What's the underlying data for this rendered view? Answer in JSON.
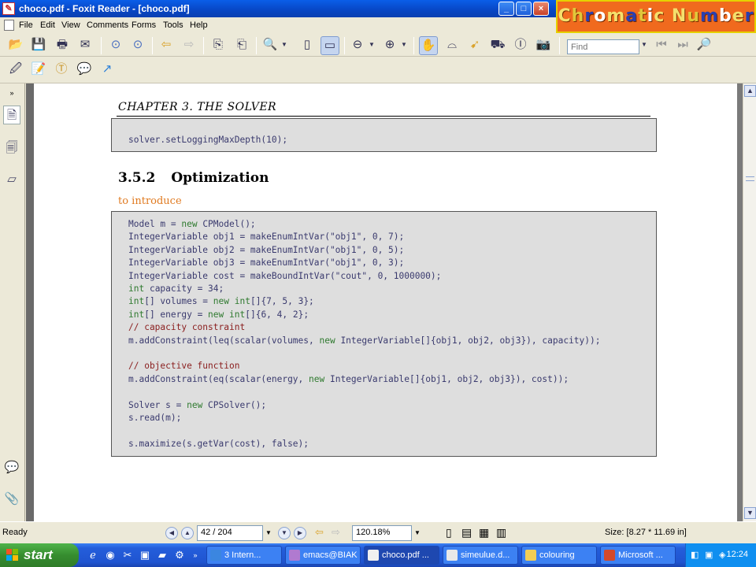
{
  "window": {
    "title": "choco.pdf - Foxit Reader - [choco.pdf]",
    "controls": [
      "_",
      "□",
      "×"
    ]
  },
  "brand": {
    "letters": [
      {
        "c": "C",
        "color": "#f4e06c"
      },
      {
        "c": "h",
        "color": "#e0c73a"
      },
      {
        "c": "r",
        "color": "#2a3fb0"
      },
      {
        "c": "o",
        "color": "#ffffff"
      },
      {
        "c": "m",
        "color": "#f4e06c"
      },
      {
        "c": "a",
        "color": "#2a3fb0"
      },
      {
        "c": "t",
        "color": "#e0c73a"
      },
      {
        "c": "i",
        "color": "#ffffff"
      },
      {
        "c": "c",
        "color": "#f4e06c"
      },
      {
        "c": " ",
        "color": "#000000"
      },
      {
        "c": "N",
        "color": "#f4e06c"
      },
      {
        "c": "u",
        "color": "#e0c73a"
      },
      {
        "c": "m",
        "color": "#2a3fb0"
      },
      {
        "c": "b",
        "color": "#ffffff"
      },
      {
        "c": "e",
        "color": "#f4e06c"
      },
      {
        "c": "r",
        "color": "#2a3fb0"
      }
    ]
  },
  "menu": [
    "File",
    "Edit",
    "View",
    "Comments",
    "Forms",
    "Tools",
    "Help"
  ],
  "toolbar": {
    "find_placeholder": "Find",
    "icons": [
      "open-icon",
      "save-icon",
      "print-icon",
      "email-icon",
      "page-up-icon",
      "page-down-icon",
      "back-icon",
      "forward-icon",
      "extract-icon",
      "insert-icon",
      "zoom-icon",
      "fit-page-icon",
      "fit-width-icon",
      "zoom-out-icon",
      "zoom-in-icon",
      "hand-icon",
      "snapshot-icon",
      "select-icon",
      "binoculars-icon",
      "text-select-icon",
      "camera-icon"
    ]
  },
  "document": {
    "chapter_header": "CHAPTER 3.   THE SOLVER",
    "code_block_1": [
      "solver.setLoggingMaxDepth(10);"
    ],
    "section_number": "3.5.2",
    "section_title": "Optimization",
    "intro_note": "to introduce",
    "code_block_2": [
      "Model m = new CPModel();",
      "IntegerVariable obj1 = makeEnumIntVar(\"obj1\", 0, 7);",
      "IntegerVariable obj2 = makeEnumIntVar(\"obj1\", 0, 5);",
      "IntegerVariable obj3 = makeEnumIntVar(\"obj1\", 0, 3);",
      "IntegerVariable cost = makeBoundIntVar(\"cout\", 0, 1000000);",
      "int capacity = 34;",
      "int[] volumes = new int[]{7, 5, 3};",
      "int[] energy = new int[]{6, 4, 2};",
      "// capacity constraint",
      "m.addConstraint(leq(scalar(volumes, new IntegerVariable[]{obj1, obj2, obj3}), capacity));",
      "",
      "// objective function",
      "m.addConstraint(eq(scalar(energy, new IntegerVariable[]{obj1, obj2, obj3}), cost));",
      "",
      "Solver s = new CPSolver();",
      "s.read(m);",
      "",
      "s.maximize(s.getVar(cost), false);"
    ]
  },
  "status": {
    "ready": "Ready",
    "page_indicator": "42 / 204",
    "zoom": "120.18%",
    "size": "Size: [8.27 * 11.69 in]"
  },
  "taskbar": {
    "start": "start",
    "items": [
      "3 Intern...",
      "emacs@BIAK",
      "choco.pdf ...",
      "simeulue.d...",
      "colouring",
      "Microsoft ..."
    ],
    "active_index": 2,
    "clock": "12:24"
  }
}
